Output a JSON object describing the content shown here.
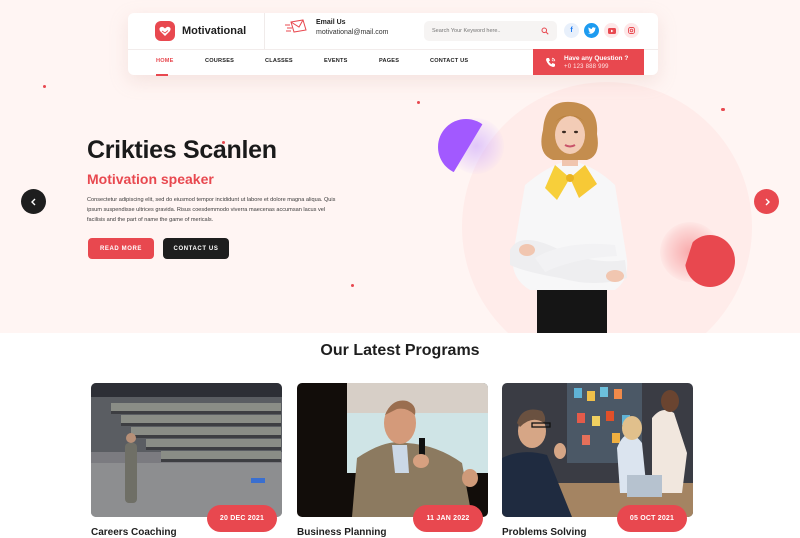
{
  "brand": {
    "name": "Motivational",
    "accent_color": "#e8484f",
    "dark_color": "#1e1e1e",
    "hero_bg": "#fff5f3"
  },
  "header": {
    "email_label": "Email Us",
    "email_value": "motivational@mail.com",
    "search_placeholder": "Search Your Keyword here..",
    "socials": [
      {
        "icon": "facebook-icon",
        "glyph": "f"
      },
      {
        "icon": "twitter-icon",
        "glyph": ""
      },
      {
        "icon": "youtube-icon",
        "glyph": ""
      },
      {
        "icon": "instagram-icon",
        "glyph": ""
      }
    ],
    "nav": [
      {
        "label": "HOME",
        "active": true
      },
      {
        "label": "COURSES",
        "active": false
      },
      {
        "label": "CLASSES",
        "active": false
      },
      {
        "label": "EVENTS",
        "active": false
      },
      {
        "label": "PAGES",
        "active": false
      },
      {
        "label": "CONTACT US",
        "active": false
      }
    ],
    "question_label": "Have any Question ?",
    "question_phone": "+0 123 888 999"
  },
  "hero": {
    "title": "Crikties Scanlen",
    "subtitle": "Motivation speaker",
    "description": "Consectetur adipiscing elit, sed do eiusmod tempor incididunt ut labore et dolore magna aliqua. Quis ipsum suspendisse ultrices gravida. Risus coesdemmodo viverra maecenas accumsan lacus vel facilisis and the part of name the game of mericals.",
    "read_more_label": "READ MORE",
    "contact_label": "CONTACT US",
    "prev_icon": "chevron-left-icon",
    "next_icon": "chevron-right-icon"
  },
  "programs": {
    "title": "Our Latest Programs",
    "items": [
      {
        "title": "Careers Coaching",
        "date": "20 DEC 2021",
        "image": "auditorium-audience-photo"
      },
      {
        "title": "Business Planning",
        "date": "11 JAN 2022",
        "image": "speaker-with-microphone-photo"
      },
      {
        "title": "Problems Solving",
        "date": "05 OCT 2021",
        "image": "office-meeting-photo"
      }
    ]
  }
}
